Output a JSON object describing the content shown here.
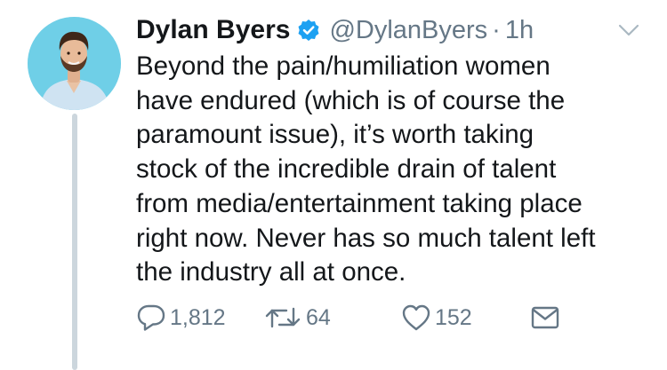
{
  "tweet": {
    "author_name": "Dylan Byers",
    "handle": "@DylanByers",
    "separator": "·",
    "time": "1h",
    "text_lines": [
      "Beyond the pain/humiliation women",
      "have endured (which is of course the",
      "paramount issue), it’s worth taking",
      "stock of the incredible drain of talent",
      "from media/entertainment taking place",
      "right now. Never has so much talent left",
      "the industry all at once."
    ],
    "actions": {
      "replies": "1,812",
      "retweets": "64",
      "likes": "152"
    },
    "icons": {
      "verified": "verified-badge-icon",
      "menu": "chevron-down-icon",
      "reply": "reply-icon",
      "retweet": "retweet-icon",
      "like": "heart-icon",
      "message": "envelope-icon"
    },
    "colors": {
      "verified": "#1da1f2",
      "text": "#14171a",
      "secondary": "#657786",
      "thread_line": "#ccd6dd",
      "avatar_bg": "#5fc8e3"
    }
  }
}
